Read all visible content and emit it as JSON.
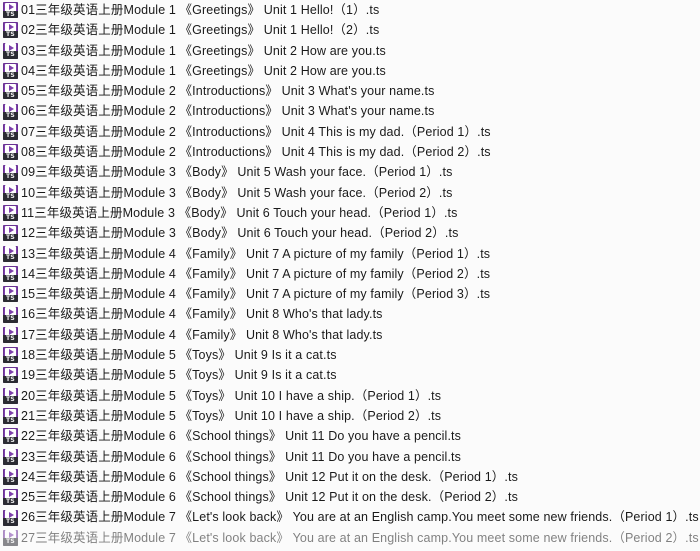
{
  "window": {
    "background_color": "#fbfbfb",
    "text_color": "#1a1a1a"
  },
  "icon": {
    "semantic_name": "ts-video-file-icon",
    "badge_label": "TS",
    "badge_background": "#2b2b33",
    "tile_color": "#7d3fab",
    "glyph": "play-triangle"
  },
  "file_list": {
    "file_type": ".ts",
    "total_visible": 27,
    "items": [
      {
        "index": "01",
        "name": "01三年级英语上册Module 1 《Greetings》 Unit 1 Hello!（1）.ts"
      },
      {
        "index": "02",
        "name": "02三年级英语上册Module 1 《Greetings》 Unit 1 Hello!（2）.ts"
      },
      {
        "index": "03",
        "name": "03三年级英语上册Module 1 《Greetings》 Unit 2 How are you.ts"
      },
      {
        "index": "04",
        "name": "04三年级英语上册Module 1 《Greetings》 Unit 2 How are you.ts"
      },
      {
        "index": "05",
        "name": "05三年级英语上册Module 2 《Introductions》 Unit 3 What's your name.ts"
      },
      {
        "index": "06",
        "name": "06三年级英语上册Module 2 《Introductions》 Unit 3 What's your name.ts"
      },
      {
        "index": "07",
        "name": "07三年级英语上册Module 2 《Introductions》 Unit 4 This is my dad.（Period 1）.ts"
      },
      {
        "index": "08",
        "name": "08三年级英语上册Module 2 《Introductions》 Unit 4 This is my dad.（Period 2）.ts"
      },
      {
        "index": "09",
        "name": "09三年级英语上册Module 3 《Body》 Unit 5 Wash your face.（Period 1）.ts"
      },
      {
        "index": "10",
        "name": "10三年级英语上册Module 3 《Body》 Unit 5 Wash your face.（Period 2）.ts"
      },
      {
        "index": "11",
        "name": "11三年级英语上册Module 3 《Body》 Unit 6 Touch your head.（Period 1）.ts"
      },
      {
        "index": "12",
        "name": "12三年级英语上册Module 3 《Body》 Unit 6 Touch your head.（Period 2）.ts"
      },
      {
        "index": "13",
        "name": "13三年级英语上册Module 4 《Family》 Unit 7 A picture of my family（Period 1）.ts"
      },
      {
        "index": "14",
        "name": "14三年级英语上册Module 4 《Family》 Unit 7 A picture of my family（Period 2）.ts"
      },
      {
        "index": "15",
        "name": "15三年级英语上册Module 4 《Family》 Unit 7 A picture of my family（Period 3）.ts"
      },
      {
        "index": "16",
        "name": "16三年级英语上册Module 4 《Family》 Unit 8 Who's that lady.ts"
      },
      {
        "index": "17",
        "name": "17三年级英语上册Module 4 《Family》 Unit 8 Who's that lady.ts"
      },
      {
        "index": "18",
        "name": "18三年级英语上册Module 5 《Toys》 Unit 9 Is it a cat.ts"
      },
      {
        "index": "19",
        "name": "19三年级英语上册Module 5 《Toys》 Unit 9 Is it a cat.ts"
      },
      {
        "index": "20",
        "name": "20三年级英语上册Module 5 《Toys》 Unit 10 I have a ship.（Period 1）.ts"
      },
      {
        "index": "21",
        "name": "21三年级英语上册Module 5 《Toys》 Unit 10 I have a ship.（Period 2）.ts"
      },
      {
        "index": "22",
        "name": "22三年级英语上册Module 6 《School things》 Unit 11 Do you have a pencil.ts"
      },
      {
        "index": "23",
        "name": "23三年级英语上册Module 6 《School things》 Unit 11 Do you have a pencil.ts"
      },
      {
        "index": "24",
        "name": "24三年级英语上册Module 6 《School things》 Unit 12 Put it on the desk.（Period 1）.ts"
      },
      {
        "index": "25",
        "name": "25三年级英语上册Module 6 《School things》 Unit 12 Put it on the desk.（Period 2）.ts"
      },
      {
        "index": "26",
        "name": "26三年级英语上册Module 7 《Let's look back》 You are at an English camp.You meet some new friends.（Period 1）.ts"
      },
      {
        "index": "27",
        "name": "27三年级英语上册Module 7 《Let's look back》 You are at an English camp.You meet some new friends.（Period 2）.ts"
      }
    ]
  }
}
